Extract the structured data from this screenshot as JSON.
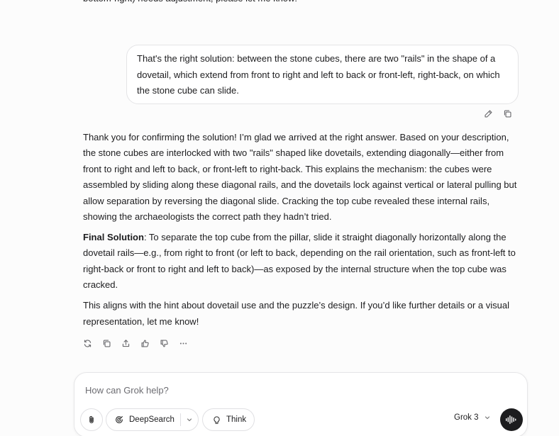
{
  "previous_message": {
    "tail_text": "bottom-right) needs adjustment, please let me know!"
  },
  "user_message": {
    "text": "That's the right solution: between the stone cubes, there are two \"rails\" in the shape of a dovetail, which extend from front to right and left to back or front-left, right-back, on which the stone cube can slide."
  },
  "assistant_message": {
    "paragraph1": "Thank you for confirming the solution! I’m glad we arrived at the right answer. Based on your description, the stone cubes are interlocked with two \"rails\" shaped like dovetails, extending diagonally—either from front to right and left to back, or front-left to right-back. This explains the mechanism: the cubes were assembled by sliding along these diagonal rails, and the dovetails lock against vertical or lateral pulling but allow separation by reversing the diagonal slide. Cracking the top cube revealed these internal rails, showing the archaeologists the correct path they hadn’t tried.",
    "final_label": "Final Solution",
    "paragraph2": ": To separate the top cube from the pillar, slide it straight diagonally horizontally along the dovetail rails—e.g., from right to front (or left to back, depending on the rail orientation, such as front-left to right-back or front to right and left to back)—as exposed by the internal structure when the top cube was cracked.",
    "paragraph3": "This aligns with the hint about dovetail use and the puzzle’s design. If you’d like further details or a visual representation, let me know!"
  },
  "composer": {
    "placeholder": "How can Grok help?",
    "deepsearch_label": "DeepSearch",
    "think_label": "Think",
    "model_label": "Grok 3"
  },
  "icons": {
    "user_actions": [
      "pencil-icon",
      "copy-icon"
    ],
    "response_actions": [
      "regenerate-icon",
      "copy-icon",
      "share-icon",
      "thumbs-up-icon",
      "thumbs-down-icon",
      "more-icon"
    ]
  },
  "colors": {
    "background": "#fcfcfc",
    "bubble": "#ffffff",
    "border": "#e4e4e6",
    "text": "#1d1d1f",
    "voice_button": "#1c1c1e"
  }
}
